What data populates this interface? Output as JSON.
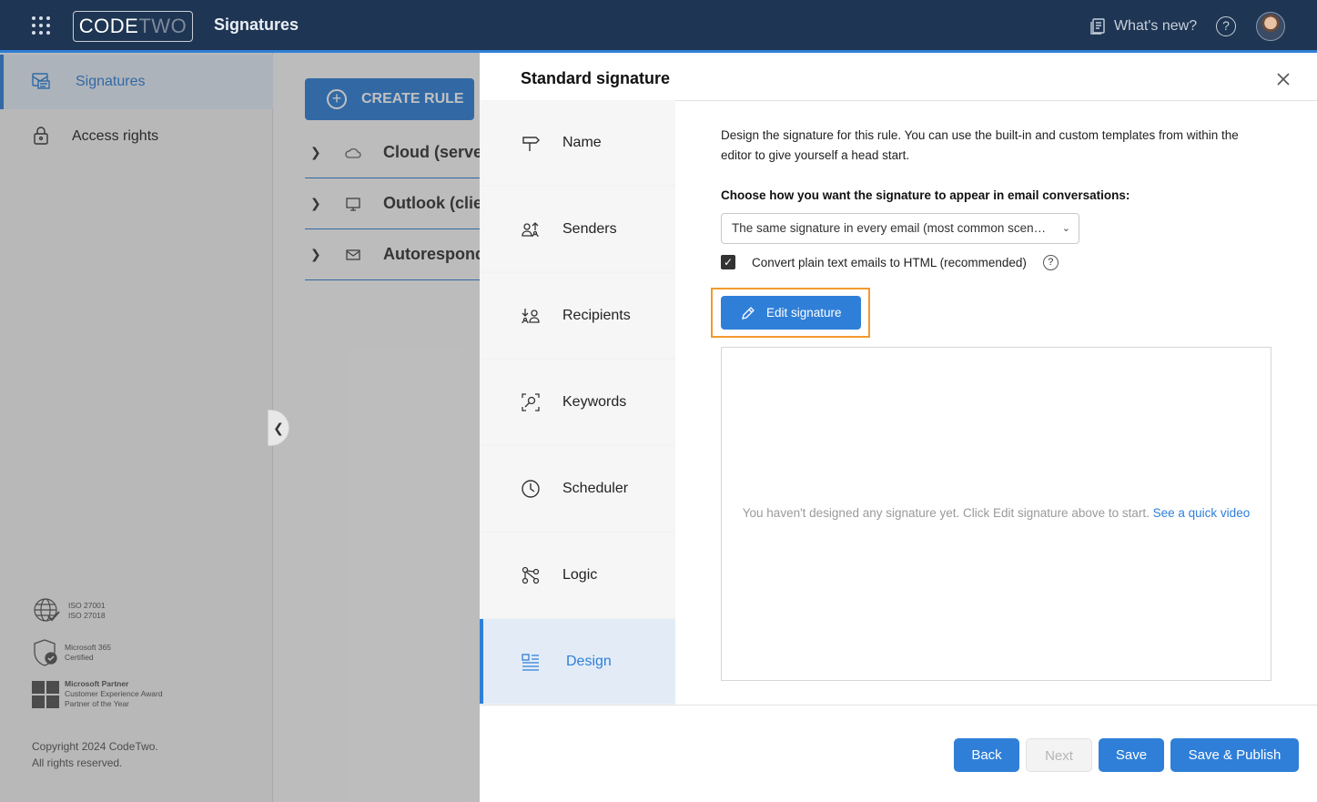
{
  "topbar": {
    "logo_part1": "CODE",
    "logo_part2": "TWO",
    "app_title": "Signatures",
    "whats_new": "What's new?",
    "help": "?"
  },
  "sidebar": {
    "items": [
      {
        "label": "Signatures",
        "icon": "signature-icon",
        "active": true
      },
      {
        "label": "Access rights",
        "icon": "lock-icon",
        "active": false
      }
    ],
    "certs": [
      {
        "lines": [
          "ISO 27001",
          "ISO 27018"
        ],
        "icon": "globe-check-icon"
      },
      {
        "lines": [
          "Microsoft 365",
          "Certified"
        ],
        "icon": "shield-check-icon"
      },
      {
        "lines": [
          "Microsoft Partner",
          "Customer Experience Award",
          "Partner of the Year"
        ],
        "icon": "microsoft-logo-icon"
      }
    ],
    "copyright_line1": "Copyright 2024 CodeTwo.",
    "copyright_line2": "All rights reserved."
  },
  "main": {
    "create_rule": "CREATE RULE",
    "rules": [
      {
        "label": "Cloud (server",
        "icon": "cloud-icon"
      },
      {
        "label": "Outlook (clie",
        "icon": "monitor-icon"
      },
      {
        "label": "Autorespond",
        "icon": "mail-reply-icon"
      }
    ]
  },
  "panel": {
    "title": "Standard signature",
    "tabs": [
      {
        "label": "Name",
        "icon": "signpost-icon"
      },
      {
        "label": "Senders",
        "icon": "senders-icon"
      },
      {
        "label": "Recipients",
        "icon": "recipients-icon"
      },
      {
        "label": "Keywords",
        "icon": "keywords-icon"
      },
      {
        "label": "Scheduler",
        "icon": "clock-icon"
      },
      {
        "label": "Logic",
        "icon": "logic-icon"
      },
      {
        "label": "Design",
        "icon": "design-icon"
      }
    ],
    "active_tab": "Design",
    "description": "Design the signature for this rule. You can use the built-in and custom templates from within the editor to give yourself a head start.",
    "choose_label": "Choose how you want the signature to appear in email conversations:",
    "select_value": "The same signature in every email (most common scenario)",
    "convert_label": "Convert plain text emails to HTML (recommended)",
    "convert_checked": true,
    "edit_signature": "Edit signature",
    "empty_message": "You haven't designed any signature yet. Click Edit signature above to start.",
    "quick_video": "See a quick video",
    "footer": {
      "back": "Back",
      "next": "Next",
      "save": "Save",
      "save_publish": "Save & Publish"
    }
  },
  "colors": {
    "accent": "#2f7fd8",
    "topbar": "#1e3553",
    "highlight": "#f39a2b"
  }
}
